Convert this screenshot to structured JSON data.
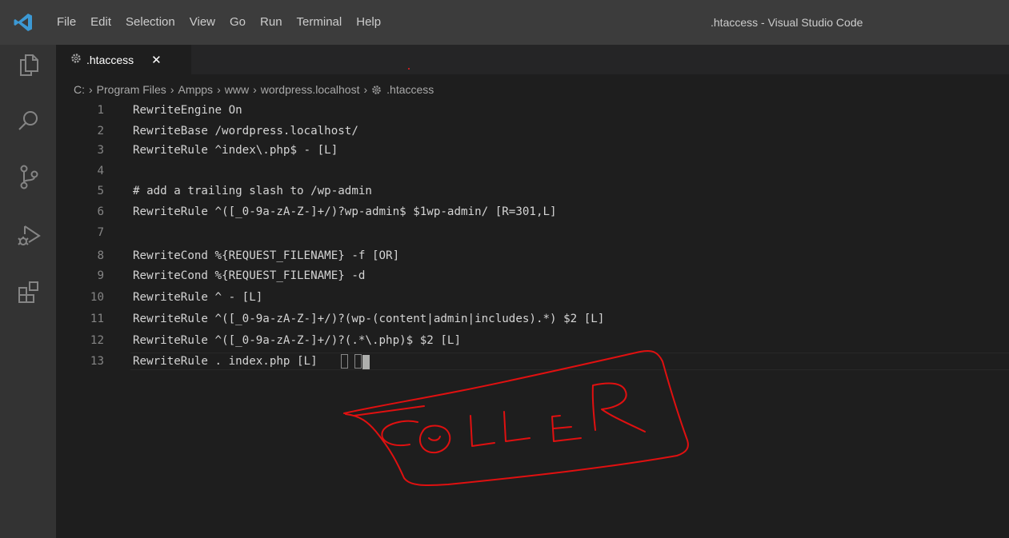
{
  "window": {
    "title": ".htaccess - Visual Studio Code"
  },
  "menu": [
    "File",
    "Edit",
    "Selection",
    "View",
    "Go",
    "Run",
    "Terminal",
    "Help"
  ],
  "tab": {
    "label": ".htaccess",
    "close": "✕"
  },
  "breadcrumb": {
    "parts": [
      "C:",
      "Program Files",
      "Ampps",
      "www",
      "wordpress.localhost",
      ".htaccess"
    ],
    "separator": "›"
  },
  "editor": {
    "lines": [
      {
        "num": "1",
        "text": "RewriteEngine On"
      },
      {
        "num": "2",
        "text": "RewriteBase /wordpress.localhost/"
      },
      {
        "num": "3",
        "text": "RewriteRule ^index\\.php$ - [L]"
      },
      {
        "num": "4",
        "text": ""
      },
      {
        "num": "5",
        "text": "# add a trailing slash to /wp-admin"
      },
      {
        "num": "6",
        "text": "RewriteRule ^([_0-9a-zA-Z-]+/)?wp-admin$ $1wp-admin/ [R=301,L]"
      },
      {
        "num": "7",
        "text": ""
      },
      {
        "num": "8",
        "text": "RewriteCond %{REQUEST_FILENAME} -f [OR]"
      },
      {
        "num": "9",
        "text": "RewriteCond %{REQUEST_FILENAME} -d"
      },
      {
        "num": "10",
        "text": "RewriteRule ^ - [L]"
      },
      {
        "num": "11",
        "text": "RewriteRule ^([_0-9a-zA-Z-]+/)?(wp-(content|admin|includes).*) $2 [L]"
      },
      {
        "num": "12",
        "text": "RewriteRule ^([_0-9a-zA-Z-]+/)?(.*\\.php)$ $2 [L]"
      },
      {
        "num": "13",
        "text": "RewriteRule . index.php [L]"
      }
    ]
  },
  "annotation": {
    "text": "COLLER",
    "color": "#e01010"
  },
  "colors": {
    "accent": "#3c99d4",
    "background": "#1e1e1e"
  },
  "icons": [
    "vscode-logo-icon",
    "explorer-icon",
    "search-icon",
    "source-control-icon",
    "run-debug-icon",
    "extensions-icon",
    "gear-icon"
  ]
}
